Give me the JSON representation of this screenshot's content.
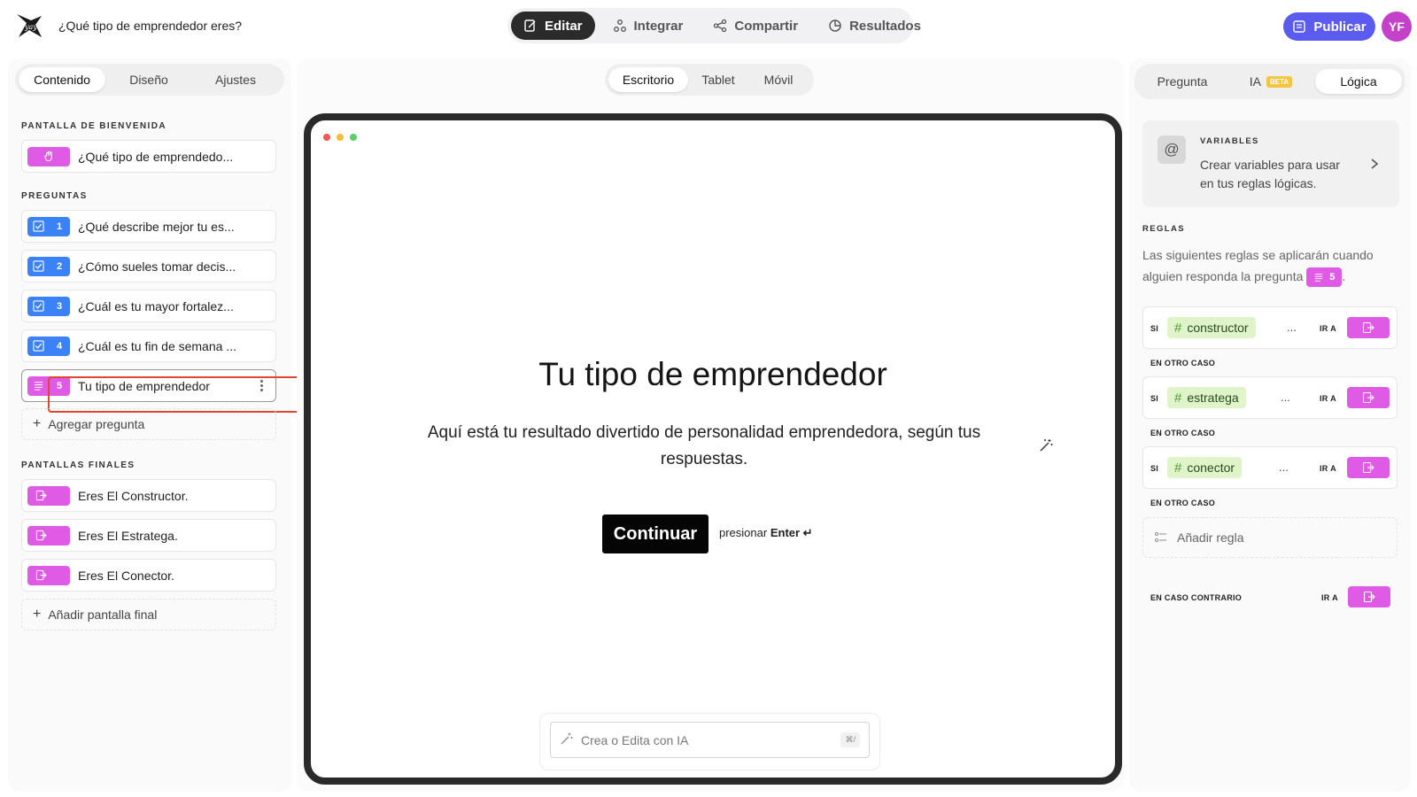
{
  "header": {
    "form_title": "¿Qué tipo de emprendedor eres?",
    "tabs": [
      {
        "label": "Editar",
        "icon": "edit-icon"
      },
      {
        "label": "Integrar",
        "icon": "integrate-icon"
      },
      {
        "label": "Compartir",
        "icon": "share-icon"
      },
      {
        "label": "Resultados",
        "icon": "results-icon"
      }
    ],
    "publish_label": "Publicar",
    "avatar_initials": "YF"
  },
  "left": {
    "tabs": [
      "Contenido",
      "Diseño",
      "Ajustes"
    ],
    "welcome_label": "PANTALLA DE BIENVENIDA",
    "welcome_item": "¿Qué tipo de emprendedo...",
    "questions_label": "PREGUNTAS",
    "questions": [
      {
        "num": "1",
        "text": "¿Qué describe mejor tu es..."
      },
      {
        "num": "2",
        "text": "¿Cómo sueles tomar decis..."
      },
      {
        "num": "3",
        "text": "¿Cuál es tu mayor fortalez..."
      },
      {
        "num": "4",
        "text": "¿Cuál es tu fin de semana ..."
      },
      {
        "num": "5",
        "text": "Tu tipo de emprendedor"
      }
    ],
    "add_question": "Agregar pregunta",
    "endings_label": "PANTALLAS FINALES",
    "endings": [
      "Eres El Constructor.",
      "Eres El Estratega.",
      "Eres El Conector."
    ],
    "add_ending": "Añadir pantalla final"
  },
  "center": {
    "devices": [
      "Escritorio",
      "Tablet",
      "Móvil"
    ],
    "title": "Tu tipo de emprendedor",
    "description": "Aquí está tu resultado divertido de personalidad emprendedora, según tus respuestas.",
    "continue_label": "Continuar",
    "press_label": "presionar",
    "press_key": "Enter ↵",
    "ai_placeholder": "Crea o Edita con IA",
    "ai_shortcut": "⌘/"
  },
  "right": {
    "tabs": [
      "Pregunta",
      "IA",
      "Lógica"
    ],
    "beta": "BETA",
    "variables_title": "VARIABLES",
    "variables_desc_1": "Crear variables para usar",
    "variables_desc_2": "en tus reglas lógicas.",
    "rules_label": "REGLAS",
    "rules_text_1": "Las siguientes reglas se aplicarán cuando",
    "rules_text_2": "alguien responda la pregunta",
    "rules_badge_num": "5",
    "if_label": "SI",
    "goto_label": "IR A",
    "ellipsis": "...",
    "rules": [
      "constructor",
      "estratega",
      "conector"
    ],
    "else_label": "EN OTRO CASO",
    "add_rule": "Añadir regla",
    "otherwise_label": "EN CASO CONTRARIO"
  },
  "colors": {
    "accent": "#5b5bf0",
    "avatar": "#c441c9",
    "question_blue": "#3b82f6",
    "ending_pink": "#e05be5",
    "tag_green": "#dff5c9",
    "highlight": "#e0452f"
  }
}
